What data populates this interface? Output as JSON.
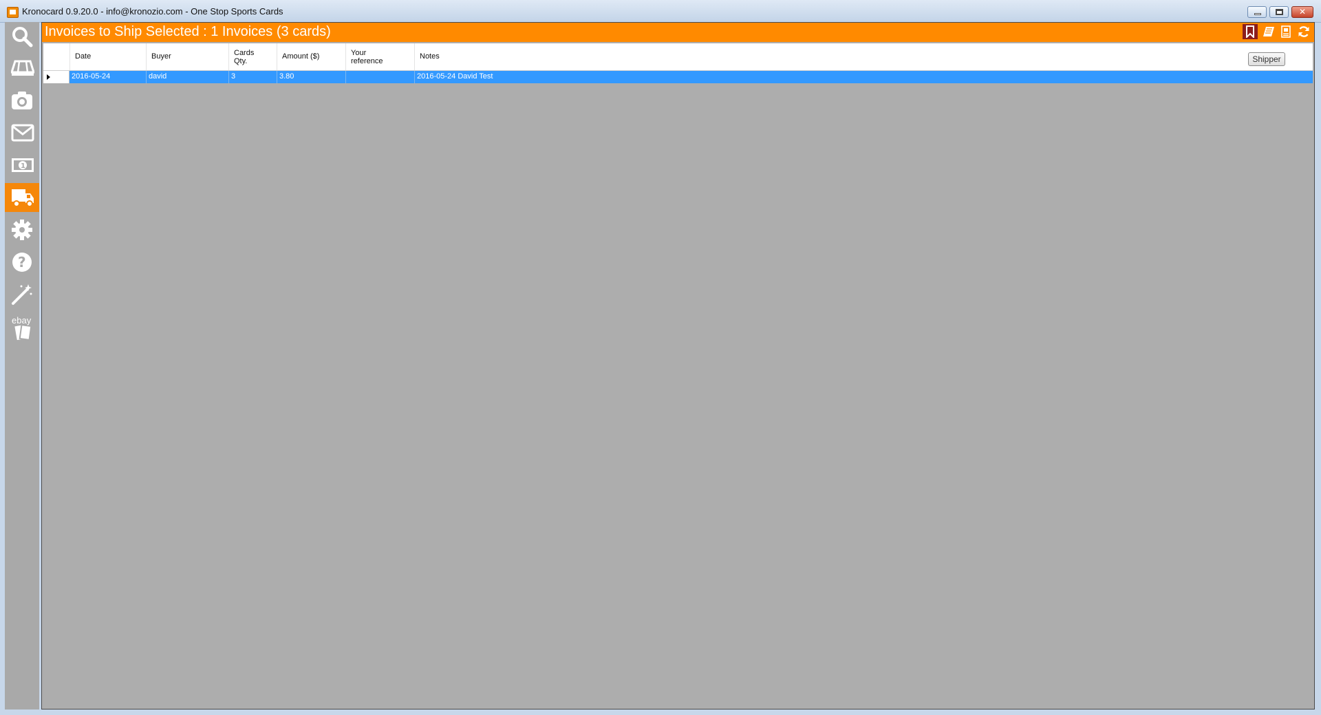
{
  "window": {
    "title": "Kronocard 0.9.20.0 - info@kronozio.com - One Stop Sports Cards"
  },
  "sidebar": {
    "items": [
      {
        "icon": "search-icon"
      },
      {
        "icon": "card-stack-icon"
      },
      {
        "icon": "camera-icon"
      },
      {
        "icon": "mail-icon"
      },
      {
        "icon": "money-icon"
      },
      {
        "icon": "truck-icon",
        "active": true
      },
      {
        "icon": "gear-icon"
      },
      {
        "icon": "help-icon"
      },
      {
        "icon": "magic-wand-icon"
      },
      {
        "icon": "ebay-icon",
        "label": "ebay"
      }
    ]
  },
  "header": {
    "title": "Invoices to Ship Selected : 1 Invoices (3 cards)",
    "icons": [
      "bookmark-icon",
      "book-icon",
      "document-icon",
      "refresh-icon"
    ]
  },
  "grid": {
    "columns": [
      "Date",
      "Buyer",
      "Cards\nQty.",
      "Amount ($)",
      "Your\nreference",
      "Notes"
    ],
    "shipper_label": "Shipper",
    "rows": [
      {
        "date": "2016-05-24",
        "buyer": "david",
        "qty": "3",
        "amount": "3.80",
        "reference": "",
        "notes": "2016-05-24 David Test"
      }
    ]
  },
  "colors": {
    "accent": "#ff8a00",
    "selection": "#3399ff",
    "sidebar": "#a9a9a9",
    "workspace": "#adadad"
  }
}
